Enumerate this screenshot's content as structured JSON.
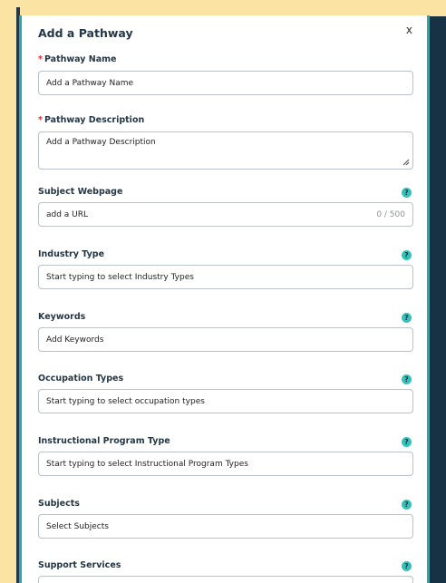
{
  "modal": {
    "title": "Add a Pathway",
    "close_label": "x"
  },
  "fields": {
    "pathway_name": {
      "label": "Pathway Name",
      "required_mark": "*",
      "placeholder": "Add a Pathway Name"
    },
    "pathway_description": {
      "label": "Pathway Description",
      "required_mark": "*",
      "placeholder": "Add a Pathway Description"
    },
    "subject_webpage": {
      "label": "Subject Webpage",
      "placeholder": "add a URL",
      "counter": "0 / 500",
      "help": "?"
    },
    "industry_type": {
      "label": "Industry Type",
      "placeholder": "Start typing to select Industry Types",
      "help": "?"
    },
    "keywords": {
      "label": "Keywords",
      "placeholder": "Add Keywords",
      "help": "?"
    },
    "occupation_types": {
      "label": "Occupation Types",
      "placeholder": "Start typing to select occupation types",
      "help": "?"
    },
    "instructional_program_type": {
      "label": "Instructional Program Type",
      "placeholder": "Start typing to select Instructional Program Types",
      "help": "?"
    },
    "subjects": {
      "label": "Subjects",
      "placeholder": "Select Subjects",
      "help": "?"
    },
    "support_services": {
      "label": "Support Services",
      "help": "?"
    }
  },
  "colors": {
    "accent": "#29a8ab",
    "help_badge": "#33c4b9",
    "required": "#d92d2d",
    "backdrop": "#fbe3a4"
  }
}
